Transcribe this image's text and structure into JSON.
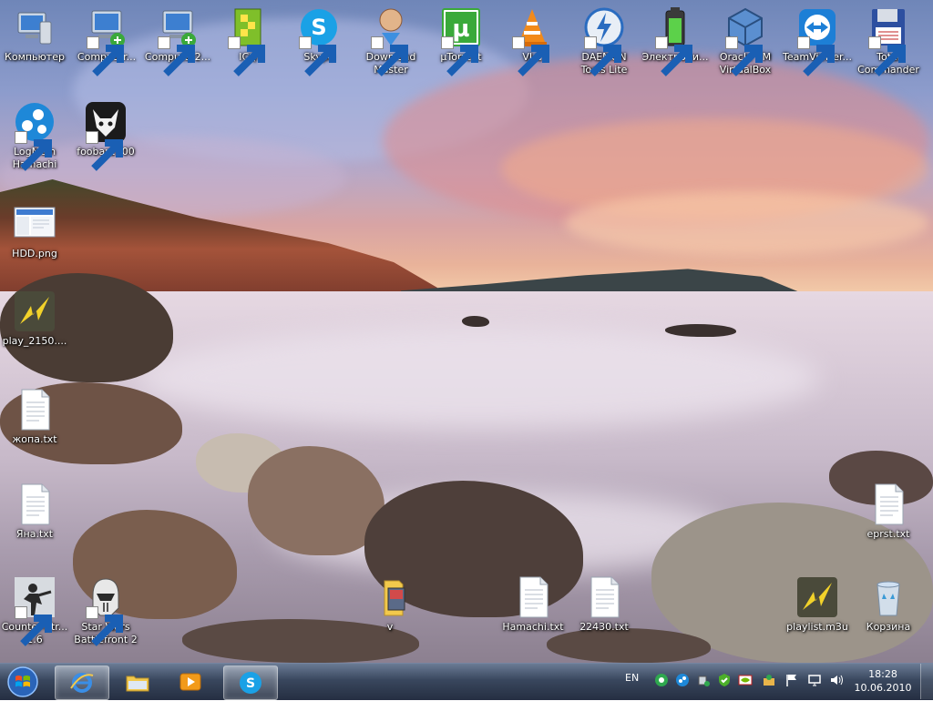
{
  "desktop": {
    "icons": [
      {
        "label": "Компьютер"
      },
      {
        "label": "Computer..."
      },
      {
        "label": "Computer2..."
      },
      {
        "label": "ICQ"
      },
      {
        "label": "Skype"
      },
      {
        "label": "Download Master"
      },
      {
        "label": "µTorrent"
      },
      {
        "label": "VLC"
      },
      {
        "label": "DAEMON Tools Lite"
      },
      {
        "label": "Электропи..."
      },
      {
        "label": "Oracle VM VirtualBox"
      },
      {
        "label": "TeamViewer..."
      },
      {
        "label": "Total Commander"
      },
      {
        "label": "LogMeIn Hamachi"
      },
      {
        "label": "foobar2000"
      },
      {
        "label": "HDD.png"
      },
      {
        "label": "play_2150...."
      },
      {
        "label": "жопа.txt"
      },
      {
        "label": "Яна.txt"
      },
      {
        "label": "Counter-Str... 1.6"
      },
      {
        "label": "Star Wars Battlefront 2"
      },
      {
        "label": "v"
      },
      {
        "label": "Hamachi.txt"
      },
      {
        "label": "22430.txt"
      },
      {
        "label": "playlist.m3u"
      },
      {
        "label": "Корзина"
      },
      {
        "label": "eprst.txt"
      }
    ]
  },
  "taskbar": {
    "pinned": [
      {
        "icon": "internet-explorer-icon"
      },
      {
        "icon": "windows-explorer-icon"
      },
      {
        "icon": "media-player-icon"
      },
      {
        "icon": "skype-icon"
      }
    ],
    "language": "EN",
    "tray_icons": [
      "hamachi-tray-icon",
      "logmein-tray-icon",
      "safely-remove-icon",
      "security-icon",
      "nvidia-icon",
      "network-tray-icon",
      "action-center-flag-icon",
      "display-icon",
      "volume-icon"
    ],
    "clock": {
      "time": "18:28",
      "date": "10.06.2010"
    }
  },
  "colors": {
    "taskbar": "#26364f",
    "accent": "#4a90d9"
  }
}
